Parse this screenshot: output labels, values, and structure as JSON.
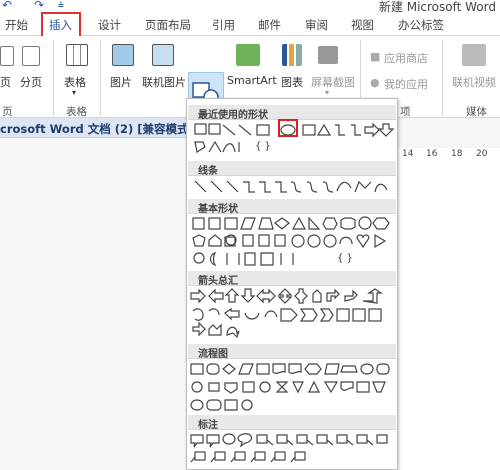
{
  "quick_access": {
    "undo_icon": "undo-icon",
    "redo_icon": "redo-icon",
    "customize_icon": "customize-icon"
  },
  "window": {
    "title": "新建 Microsoft Word"
  },
  "tabs": [
    "开始",
    "插入",
    "设计",
    "页面布局",
    "引用",
    "邮件",
    "审阅",
    "视图",
    "办公标签"
  ],
  "active_tab": "插入",
  "ribbon": {
    "pages": {
      "page_label": "页",
      "blank_label": "分页",
      "group_label": "页"
    },
    "tables": {
      "table_label": "表格",
      "group_label": "表格"
    },
    "illustrations": {
      "picture": "图片",
      "online_picture": "联机图片",
      "shapes": "形状",
      "smartart": "SmartArt",
      "chart": "图表",
      "screenshot": "屏幕截图"
    },
    "apps": {
      "store": "应用商店",
      "my_apps": "我的应用",
      "group_label": "项"
    },
    "media": {
      "online_video": "联机视频",
      "group_label": "媒体"
    }
  },
  "document_tab": "crosoft Word 文档 (2) [兼容模式] *",
  "ruler": [
    "14",
    "16",
    "18",
    "20"
  ],
  "gallery": {
    "sections": [
      "最近使用的形状",
      "线条",
      "基本形状",
      "箭头总汇",
      "流程图",
      "标注"
    ],
    "selected_shape": "oval",
    "recent": "{ }",
    "basic_braces": "{ }"
  },
  "colors": {
    "accent": "#2b579a",
    "highlight": "#e02020",
    "shapes_button_bg": "#cde3f7"
  }
}
